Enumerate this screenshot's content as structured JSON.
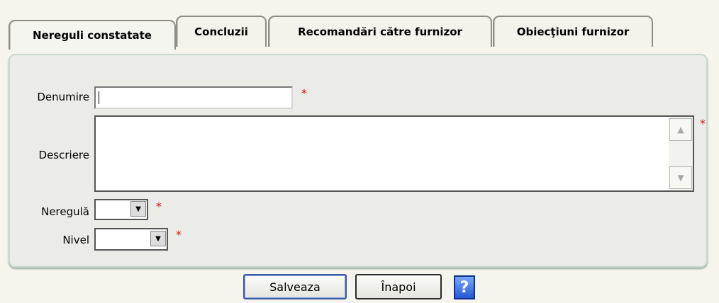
{
  "tabs": [
    {
      "label": "Nereguli constatate",
      "active": true
    },
    {
      "label": "Concluzii",
      "active": false
    },
    {
      "label": "Recomandări către furnizor",
      "active": false
    },
    {
      "label": "Obiecţiuni furnizor",
      "active": false
    }
  ],
  "form": {
    "denumire_label": "Denumire",
    "denumire_value": "",
    "descriere_label": "Descriere",
    "descriere_value": "",
    "neregula_label": "Neregulă",
    "neregula_value": "",
    "nivel_label": "Nivel",
    "nivel_value": "",
    "required_marker": "*"
  },
  "buttons": {
    "save_label": "Salveaza",
    "back_label": "Înapoi",
    "help_label": "?"
  },
  "icons": {
    "scroll_up": "triangle-up-icon",
    "scroll_down": "triangle-down-icon",
    "dropdown": "chevron-down-icon",
    "help": "help-icon"
  },
  "colors": {
    "required": "#dd1111",
    "panel": "#ebebe7",
    "help": "#2458d6"
  }
}
